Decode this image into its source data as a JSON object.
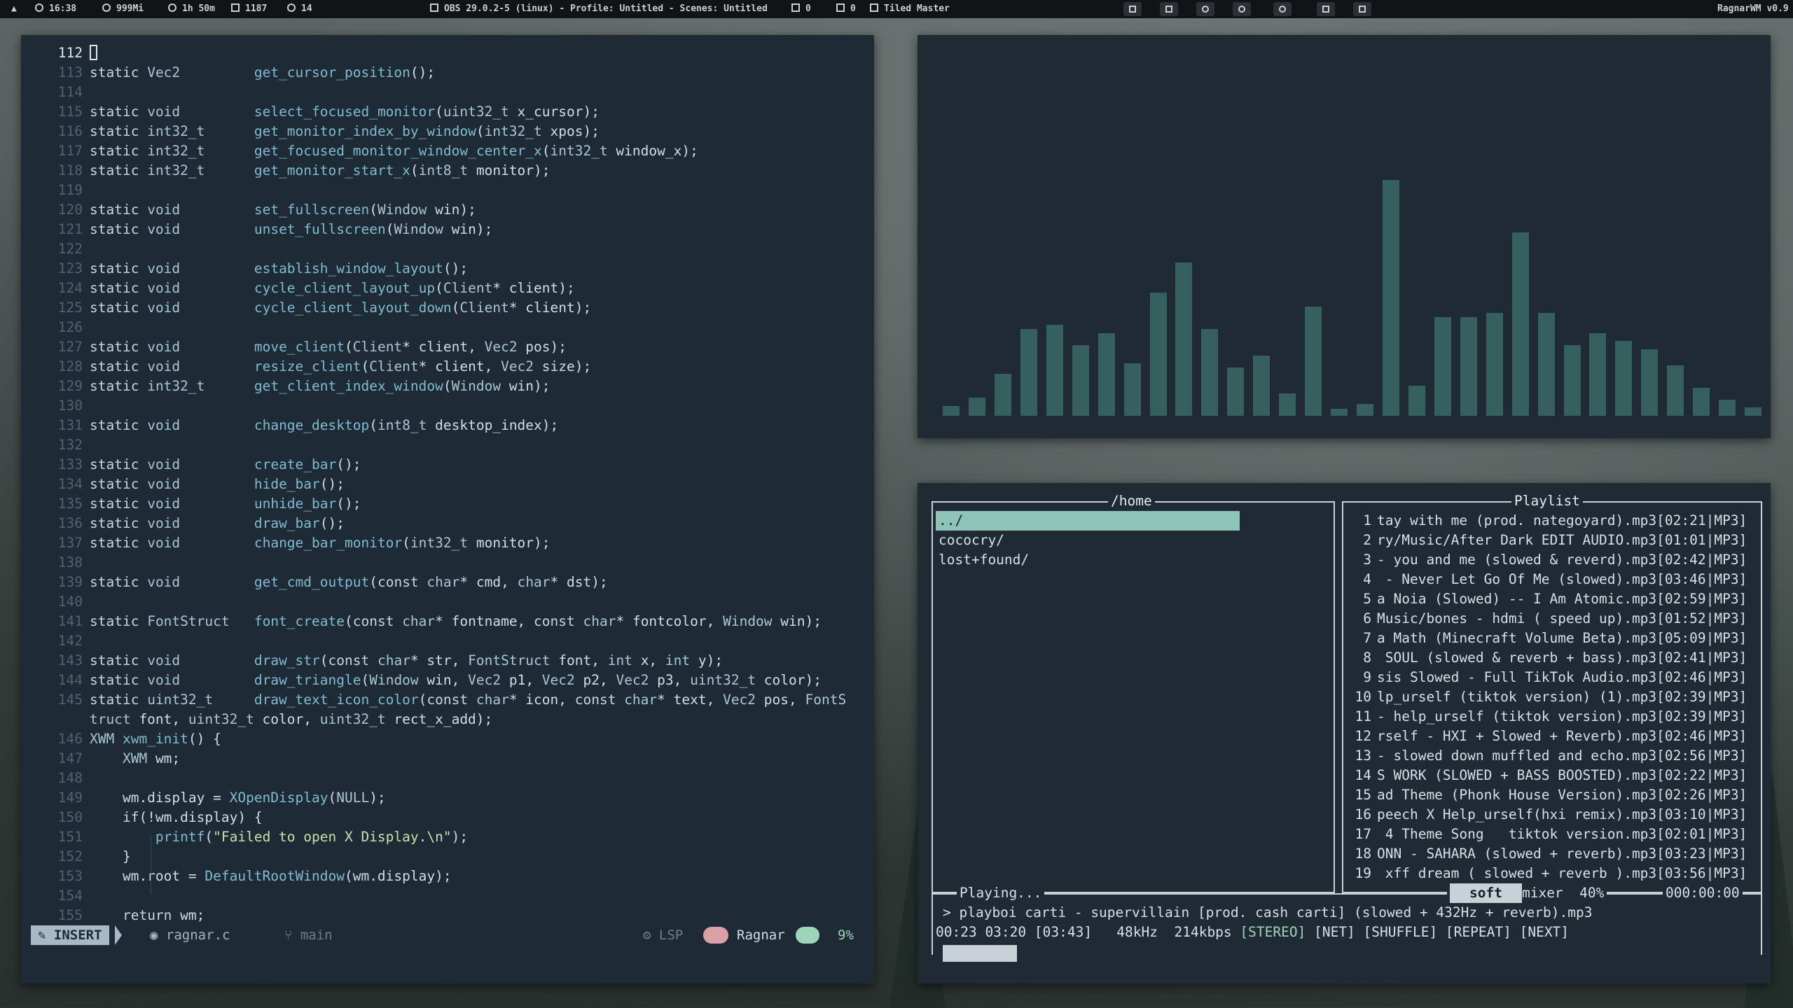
{
  "topbar": {
    "time": "16:38",
    "memory": "999Mi",
    "uptime": "1h 50m",
    "processes": "1187",
    "updates": "14",
    "window_title": "OBS 29.0.2-5 (linux) - Profile: Untitled - Scenes: Untitled",
    "notif_count": "0",
    "desk_count": "0",
    "layout": "Tiled Master",
    "wm_name": "RagnarWM v0.9"
  },
  "editor": {
    "lines": [
      {
        "n": "112",
        "html": "<span class=\"cursor-box\"></span>",
        "cur": true
      },
      {
        "n": "113",
        "html": "<span class=\"kw\">static</span> <span class=\"ty\">Vec2</span>         <span class=\"fn\">get_cursor_position</span>();"
      },
      {
        "n": "114",
        "html": ""
      },
      {
        "n": "115",
        "html": "<span class=\"kw\">static</span> <span class=\"ty\">void</span>         <span class=\"fn\">select_focused_monitor</span>(<span class=\"ty\">uint32_t</span> x_cursor);"
      },
      {
        "n": "116",
        "html": "<span class=\"kw\">static</span> <span class=\"ty\">int32_t</span>      <span class=\"fn\">get_monitor_index_by_window</span>(<span class=\"ty\">int32_t</span> xpos);"
      },
      {
        "n": "117",
        "html": "<span class=\"kw\">static</span> <span class=\"ty\">int32_t</span>      <span class=\"fn\">get_focused_monitor_window_center_x</span>(<span class=\"ty\">int32_t</span> window_x);"
      },
      {
        "n": "118",
        "html": "<span class=\"kw\">static</span> <span class=\"ty\">int32_t</span>      <span class=\"fn\">get_monitor_start_x</span>(<span class=\"ty\">int8_t</span> monitor);"
      },
      {
        "n": "119",
        "html": ""
      },
      {
        "n": "120",
        "html": "<span class=\"kw\">static</span> <span class=\"ty\">void</span>         <span class=\"fn\">set_fullscreen</span>(<span class=\"ty\">Window</span> win);"
      },
      {
        "n": "121",
        "html": "<span class=\"kw\">static</span> <span class=\"ty\">void</span>         <span class=\"fn\">unset_fullscreen</span>(<span class=\"ty\">Window</span> win);"
      },
      {
        "n": "122",
        "html": ""
      },
      {
        "n": "123",
        "html": "<span class=\"kw\">static</span> <span class=\"ty\">void</span>         <span class=\"fn\">establish_window_layout</span>();"
      },
      {
        "n": "124",
        "html": "<span class=\"kw\">static</span> <span class=\"ty\">void</span>         <span class=\"fn\">cycle_client_layout_up</span>(<span class=\"ty\">Client</span>* client);"
      },
      {
        "n": "125",
        "html": "<span class=\"kw\">static</span> <span class=\"ty\">void</span>         <span class=\"fn\">cycle_client_layout_down</span>(<span class=\"ty\">Client</span>* client);"
      },
      {
        "n": "126",
        "html": ""
      },
      {
        "n": "127",
        "html": "<span class=\"kw\">static</span> <span class=\"ty\">void</span>         <span class=\"fn\">move_client</span>(<span class=\"ty\">Client</span>* client, <span class=\"ty\">Vec2</span> pos);"
      },
      {
        "n": "128",
        "html": "<span class=\"kw\">static</span> <span class=\"ty\">void</span>         <span class=\"fn\">resize_client</span>(<span class=\"ty\">Client</span>* client, <span class=\"ty\">Vec2</span> size);"
      },
      {
        "n": "129",
        "html": "<span class=\"kw\">static</span> <span class=\"ty\">int32_t</span>      <span class=\"fn\">get_client_index_window</span>(<span class=\"ty\">Window</span> win);"
      },
      {
        "n": "130",
        "html": ""
      },
      {
        "n": "131",
        "html": "<span class=\"kw\">static</span> <span class=\"ty\">void</span>         <span class=\"fn\">change_desktop</span>(<span class=\"ty\">int8_t</span> desktop_index);"
      },
      {
        "n": "132",
        "html": ""
      },
      {
        "n": "133",
        "html": "<span class=\"kw\">static</span> <span class=\"ty\">void</span>         <span class=\"fn\">create_bar</span>();"
      },
      {
        "n": "134",
        "html": "<span class=\"kw\">static</span> <span class=\"ty\">void</span>         <span class=\"fn\">hide_bar</span>();"
      },
      {
        "n": "135",
        "html": "<span class=\"kw\">static</span> <span class=\"ty\">void</span>         <span class=\"fn\">unhide_bar</span>();"
      },
      {
        "n": "136",
        "html": "<span class=\"kw\">static</span> <span class=\"ty\">void</span>         <span class=\"fn\">draw_bar</span>();"
      },
      {
        "n": "137",
        "html": "<span class=\"kw\">static</span> <span class=\"ty\">void</span>         <span class=\"fn\">change_bar_monitor</span>(<span class=\"ty\">int32_t</span> monitor);"
      },
      {
        "n": "138",
        "html": ""
      },
      {
        "n": "139",
        "html": "<span class=\"kw\">static</span> <span class=\"ty\">void</span>         <span class=\"fn\">get_cmd_output</span>(<span class=\"kw\">const</span> <span class=\"ty\">char</span>* cmd, <span class=\"ty\">char</span>* dst);"
      },
      {
        "n": "140",
        "html": ""
      },
      {
        "n": "141",
        "html": "<span class=\"kw\">static</span> <span class=\"ty\">FontStruct</span>   <span class=\"fn\">font_create</span>(<span class=\"kw\">const</span> <span class=\"ty\">char</span>* fontname, <span class=\"kw\">const</span> <span class=\"ty\">char</span>* fontcolor, <span class=\"ty\">Window</span> win);"
      },
      {
        "n": "142",
        "html": ""
      },
      {
        "n": "143",
        "html": "<span class=\"kw\">static</span> <span class=\"ty\">void</span>         <span class=\"fn\">draw_str</span>(<span class=\"kw\">const</span> <span class=\"ty\">char</span>* str, <span class=\"ty\">FontStruct</span> font, <span class=\"ty\">int</span> x, <span class=\"ty\">int</span> y);"
      },
      {
        "n": "144",
        "html": "<span class=\"kw\">static</span> <span class=\"ty\">void</span>         <span class=\"fn\">draw_triangle</span>(<span class=\"ty\">Window</span> win, <span class=\"ty\">Vec2</span> p1, <span class=\"ty\">Vec2</span> p2, <span class=\"ty\">Vec2</span> p3, <span class=\"ty\">uint32_t</span> color);"
      },
      {
        "n": "145",
        "html": "<span class=\"kw\">static</span> <span class=\"ty\">uint32_t</span>     <span class=\"fn\">draw_text_icon_color</span>(<span class=\"kw\">const</span> <span class=\"ty\">char</span>* icon, <span class=\"kw\">const</span> <span class=\"ty\">char</span>* text, <span class=\"ty\">Vec2</span> pos, <span class=\"ty\">FontS</span>"
      },
      {
        "n": "",
        "html": "<span class=\"ty\">truct</span> font, <span class=\"ty\">uint32_t</span> color, <span class=\"ty\">uint32_t</span> rect_x_add);"
      },
      {
        "n": "146",
        "html": "<span class=\"ty\">XWM</span> <span class=\"fn\">xwm_init</span>() {"
      },
      {
        "n": "147",
        "html": "    <span class=\"ty\">XWM</span> wm;"
      },
      {
        "n": "148",
        "html": ""
      },
      {
        "n": "149",
        "html": "    wm.display = <span class=\"fn\">XOpenDisplay</span>(<span class=\"ty\">NULL</span>);"
      },
      {
        "n": "150",
        "html": "    <span class=\"kw\">if</span>(!wm.display) {"
      },
      {
        "n": "151",
        "html": "        <span class=\"fn\">printf</span>(<span class=\"str\">\"Failed to open X Display.\\n\"</span>);"
      },
      {
        "n": "152",
        "html": "    }"
      },
      {
        "n": "153",
        "html": "    wm.root = <span class=\"fn\">DefaultRootWindow</span>(wm.display);"
      },
      {
        "n": "154",
        "html": ""
      },
      {
        "n": "155",
        "html": "    <span class=\"kw\">return</span> wm;"
      }
    ],
    "status": {
      "mode": "INSERT",
      "filename": "ragnar.c",
      "branch": "main",
      "lsp": "LSP",
      "user": "Ragnar",
      "progress": "9%"
    }
  },
  "visualizer": {
    "bar_color": "#35605e",
    "levels": [
      0.025,
      0.045,
      0.105,
      0.215,
      0.225,
      0.175,
      0.205,
      0.13,
      0.305,
      0.38,
      0.215,
      0.12,
      0.15,
      0.055,
      0.27,
      0.018,
      0.03,
      0.585,
      0.075,
      0.245,
      0.245,
      0.255,
      0.455,
      0.255,
      0.175,
      0.205,
      0.185,
      0.165,
      0.125,
      0.07,
      0.04,
      0.02
    ]
  },
  "player": {
    "browser_title": "/home",
    "browser_items": [
      "../",
      "cococry/",
      "lost+found/"
    ],
    "playlist_title": "Playlist",
    "playlist": [
      {
        "n": "1",
        "t": "tay with me (prod. nategoyard).mp3[02:21|MP3]"
      },
      {
        "n": "2",
        "t": "ry/Music/After Dark EDIT AUDIO.mp3[01:01|MP3]"
      },
      {
        "n": "3",
        "t": "- you and me (slowed & reverd).mp3[02:42|MP3]"
      },
      {
        "n": "4",
        "t": " - Never Let Go Of Me (slowed).mp3[03:46|MP3]"
      },
      {
        "n": "5",
        "t": "a Noia (Slowed) -- I Am Atomic.mp3[02:59|MP3]"
      },
      {
        "n": "6",
        "t": "Music/bones - hdmi ( speed up).mp3[01:52|MP3]"
      },
      {
        "n": "7",
        "t": "a Math (Minecraft Volume Beta).mp3[05:09|MP3]"
      },
      {
        "n": "8",
        "t": " SOUL (slowed & reverb + bass).mp3[02:41|MP3]"
      },
      {
        "n": "9",
        "t": "sis Slowed - Full TikTok Audio.mp3[02:46|MP3]"
      },
      {
        "n": "10",
        "t": "lp_urself (tiktok version) (1).mp3[02:39|MP3]"
      },
      {
        "n": "11",
        "t": "- help_urself (tiktok version).mp3[02:39|MP3]"
      },
      {
        "n": "12",
        "t": "rself - HXI + Slowed + Reverb).mp3[02:46|MP3]"
      },
      {
        "n": "13",
        "t": "- slowed down muffled and echo.mp3[02:56|MP3]"
      },
      {
        "n": "14",
        "t": "S WORK (SLOWED + BASS BOOSTED).mp3[02:22|MP3]"
      },
      {
        "n": "15",
        "t": "ad Theme (Phonk House Version).mp3[02:26|MP3]"
      },
      {
        "n": "16",
        "t": "peech X Help_urself(hxi remix).mp3[03:10|MP3]"
      },
      {
        "n": "17",
        "t": " 4 Theme Song   tiktok version.mp3[02:01|MP3]"
      },
      {
        "n": "18",
        "t": "ONN - SAHARA (slowed + reverb).mp3[03:23|MP3]"
      },
      {
        "n": "19",
        "t": " xff dream ( slowed + reverb ).mp3[03:56|MP3]"
      }
    ],
    "playing_label": "Playing...",
    "soft_label": "soft",
    "mixer_label": "mixer",
    "volume": "40%",
    "elapsed_total": "000:00:00",
    "now_playing": "> playboi carti - supervillain [prod. cash carti] (slowed + 432Hz + reverb).mp3",
    "time_info": "00:23 03:20 [03:43]",
    "sample_rate": "48kHz",
    "bitrate": "214kbps",
    "stereo": "[STEREO]",
    "flags": "[NET] [SHUFFLE] [REPEAT] [NEXT]"
  }
}
